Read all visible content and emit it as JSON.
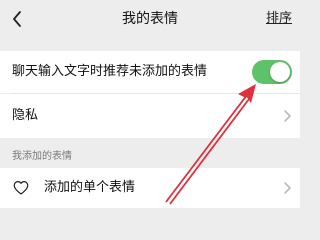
{
  "header": {
    "title": "我的表情",
    "action_label": "排序",
    "back_icon": "chevron-left-icon"
  },
  "settings": {
    "recommend_label": "聊天输入文字时推荐未添加的表情",
    "recommend_enabled": true,
    "privacy_label": "隐私"
  },
  "section": {
    "title": "我添加的表情",
    "items": [
      {
        "label": "添加的单个表情",
        "icon": "heart-icon"
      }
    ]
  },
  "colors": {
    "toggle_on": "#5ec26a",
    "annotation_arrow": "#e0303a",
    "background": "#ededed"
  }
}
